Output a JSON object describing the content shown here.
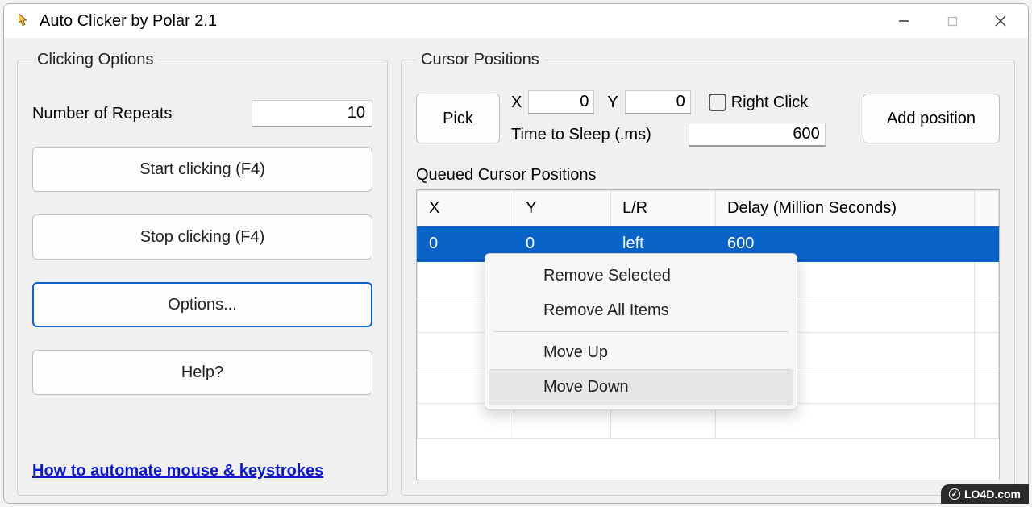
{
  "window": {
    "title": "Auto Clicker by Polar 2.1"
  },
  "clicking": {
    "legend": "Clicking Options",
    "repeats_label": "Number of Repeats",
    "repeats_value": "10",
    "start_label": "Start clicking (F4)",
    "stop_label": "Stop clicking (F4)",
    "options_label": "Options...",
    "help_label": "Help?",
    "link_label": "How to automate mouse & keystrokes"
  },
  "cursor": {
    "legend": "Cursor Positions",
    "pick_label": "Pick",
    "x_label": "X",
    "x_value": "0",
    "y_label": "Y",
    "y_value": "0",
    "right_click_label": "Right Click",
    "sleep_label": "Time to Sleep (.ms)",
    "sleep_value": "600",
    "add_label": "Add position",
    "queued_label": "Queued Cursor Positions",
    "headers": {
      "x": "X",
      "y": "Y",
      "lr": "L/R",
      "delay": "Delay (Million Seconds)"
    },
    "rows": [
      {
        "x": "0",
        "y": "0",
        "lr": "left",
        "delay": "600"
      }
    ]
  },
  "context_menu": {
    "remove_selected": "Remove Selected",
    "remove_all": "Remove All Items",
    "move_up": "Move Up",
    "move_down": "Move Down"
  },
  "watermark": "LO4D.com"
}
